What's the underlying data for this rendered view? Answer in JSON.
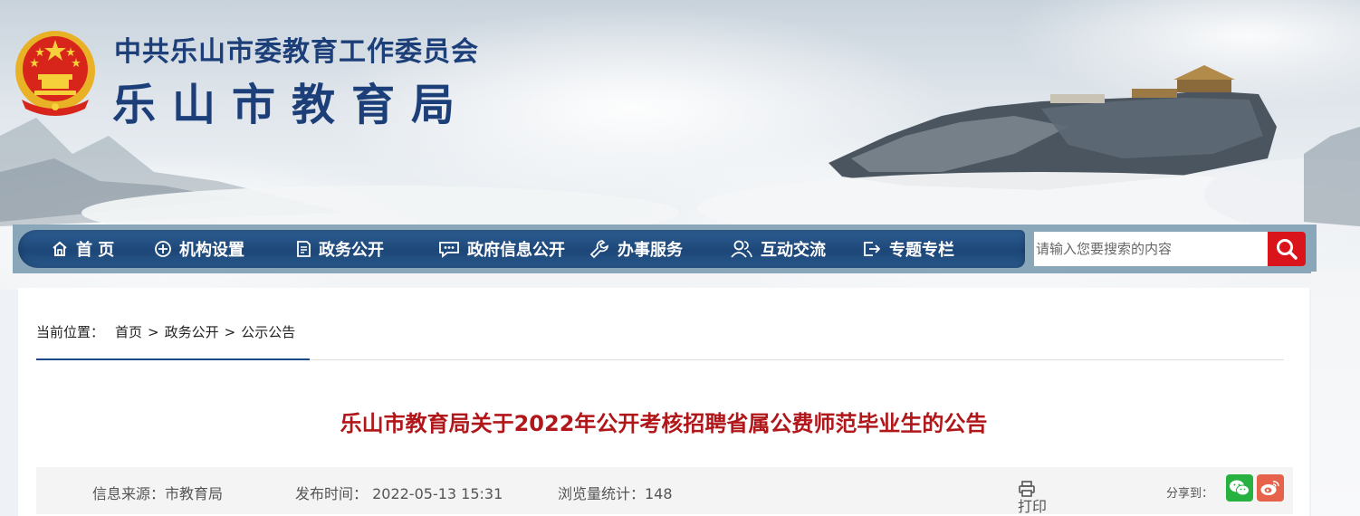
{
  "header": {
    "org_title": "中共乐山市委教育工作委员会",
    "site_title": "乐山市教育局",
    "emblem_icon": "national-emblem-icon"
  },
  "nav": {
    "items": [
      {
        "label": "首 页",
        "icon": "home-icon"
      },
      {
        "label": "机构设置",
        "icon": "plus-circle-icon"
      },
      {
        "label": "政务公开",
        "icon": "document-icon"
      },
      {
        "label": "政府信息公开",
        "icon": "chat-icon"
      },
      {
        "label": "办事服务",
        "icon": "wrench-icon"
      },
      {
        "label": "互动交流",
        "icon": "users-icon"
      },
      {
        "label": "专题专栏",
        "icon": "exit-icon"
      }
    ],
    "search_placeholder": "请输入您要搜索的内容",
    "search_icon": "search-icon"
  },
  "breadcrumb": {
    "label": "当前位置：",
    "items": [
      "首页",
      "政务公开",
      "公示公告"
    ],
    "separator": ">"
  },
  "article": {
    "title": "乐山市教育局关于2022年公开考核招聘省属公费师范毕业生的公告",
    "source": "信息来源：市教育局",
    "publish_time": "发布时间：  2022-05-13 15:31",
    "views": "浏览量统计：148",
    "print_label": "打印",
    "share_label": "分享到："
  },
  "colors": {
    "brand_blue": "#1d3f79",
    "nav_blue": "#1c4677",
    "accent_red": "#d9151b",
    "title_red": "#b1171a",
    "wechat_green": "#26b140",
    "weibo_red": "#e6624a"
  }
}
